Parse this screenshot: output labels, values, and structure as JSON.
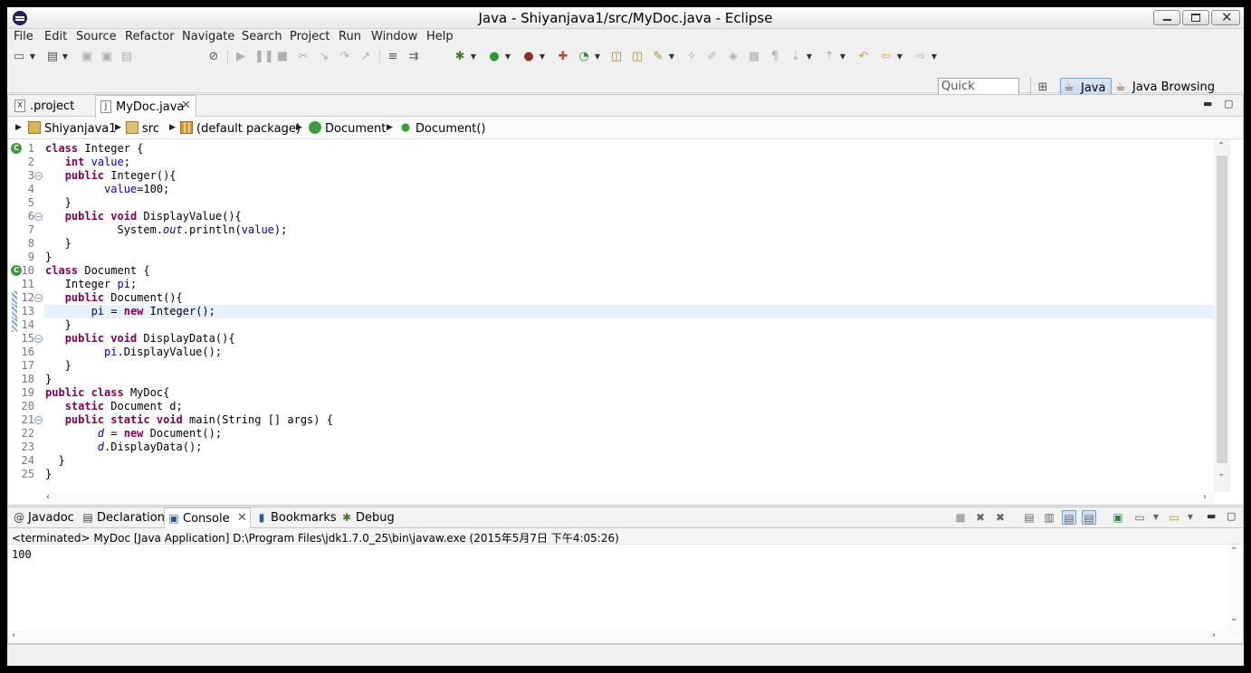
{
  "window": {
    "title": "Java - Shiyanjava1/src/MyDoc.java - Eclipse"
  },
  "menu": [
    "File",
    "Edit",
    "Source",
    "Refactor",
    "Navigate",
    "Search",
    "Project",
    "Run",
    "Window",
    "Help"
  ],
  "toolbar": {
    "quick_access": "Quick Access",
    "perspective_java": "Java",
    "perspective_java_browsing": "Java Browsing"
  },
  "editor": {
    "tabs": [
      {
        "label": ".project",
        "icon": "x-file-icon"
      },
      {
        "label": "MyDoc.java",
        "icon": "java-file-icon",
        "active": true
      }
    ],
    "breadcrumb": [
      "Shiyanjava1",
      "src",
      "(default package)",
      "Document",
      "Document()"
    ],
    "line_numbers": [
      "1",
      "2",
      "3",
      "4",
      "5",
      "6",
      "7",
      "8",
      "9",
      "10",
      "11",
      "12",
      "13",
      "14",
      "15",
      "16",
      "17",
      "18",
      "19",
      "20",
      "21",
      "22",
      "23",
      "24",
      "25"
    ],
    "cursor_line": 13,
    "code": [
      "class Integer {",
      "   int value;",
      "   public Integer(){",
      "         value=100;",
      "   }",
      "   public void DisplayValue(){",
      "           System.out.println(value);",
      "   }",
      "}",
      "class Document {",
      "   Integer pi;",
      "   public Document(){",
      "       pi = new Integer();",
      "   }",
      "   public void DisplayData(){",
      "         pi.DisplayValue();",
      "   }",
      "}",
      "public class MyDoc{",
      "   static Document d;",
      "   public static void main(String [] args) {",
      "        d = new Document();",
      "        d.DisplayData();",
      "  }",
      "}"
    ]
  },
  "bottom": {
    "tabs": [
      {
        "label": "Javadoc",
        "icon": "at-icon"
      },
      {
        "label": "Declaration",
        "icon": "declaration-icon"
      },
      {
        "label": "Console",
        "icon": "console-icon",
        "active": true
      },
      {
        "label": "Bookmarks",
        "icon": "bookmark-icon"
      },
      {
        "label": "Debug",
        "icon": "bug-icon"
      }
    ],
    "console_description": "<terminated> MyDoc [Java Application] D:\\Program Files\\jdk1.7.0_25\\bin\\javaw.exe (2015年5月7日 下午4:05:26)",
    "console_output": "100"
  },
  "colors": {
    "keyword": "#7f0055",
    "field": "#0000c0",
    "cursor_line": "#e8f2fe",
    "marker_green": "#3f9b3f"
  }
}
